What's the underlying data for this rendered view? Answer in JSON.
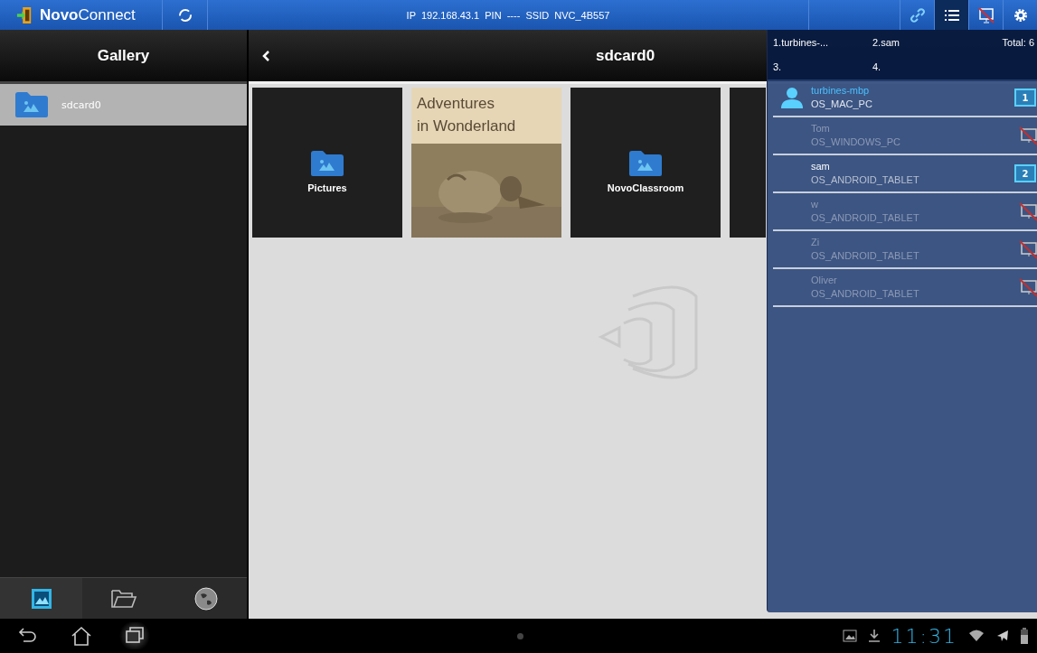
{
  "top_bar": {
    "app_name": "**Novo**Connect",
    "connection": "IP  192.168.43.1  PIN  ----  SSID  NVC_4B557",
    "tools": [
      {
        "kind": "link",
        "selected": false
      },
      {
        "kind": "list",
        "selected": true
      },
      {
        "kind": "screen_off",
        "selected": false
      },
      {
        "kind": "settings",
        "selected": false
      }
    ]
  },
  "sidebar": {
    "title": "Gallery",
    "items": [
      {
        "label": "sdcard0",
        "selected": true
      }
    ],
    "tabs": [
      {
        "kind": "gallery",
        "selected": true
      },
      {
        "kind": "folder",
        "selected": false
      },
      {
        "kind": "globe",
        "selected": false
      }
    ]
  },
  "content": {
    "title": "sdcard0",
    "tiles": [
      {
        "kind": "folder",
        "label": "Pictures"
      },
      {
        "kind": "picture",
        "label": "Adventures\nin Wonderland"
      },
      {
        "kind": "folder",
        "label": "NovoClassroom"
      },
      {
        "kind": "folder"
      }
    ]
  },
  "device_panel": {
    "slots": [
      "1.turbines-...",
      "2.sam",
      "3.",
      "4."
    ],
    "total": "Total: 6",
    "devices": [
      {
        "name": "turbines-mbp",
        "os": "OS_MAC_PC",
        "kind": "self",
        "slot": "1"
      },
      {
        "name": "Tom",
        "os": "OS_WINDOWS_PC",
        "kind": "idle"
      },
      {
        "name": "sam",
        "os": "OS_ANDROID_TABLET",
        "kind": "online",
        "slot": "2"
      },
      {
        "name": "w",
        "os": "OS_ANDROID_TABLET",
        "kind": "idle"
      },
      {
        "name": "Zi",
        "os": "OS_ANDROID_TABLET",
        "kind": "idle"
      },
      {
        "name": "Oliver",
        "os": "OS_ANDROID_TABLET",
        "kind": "idle"
      }
    ]
  },
  "nav_bar": {
    "time": "11:31"
  }
}
